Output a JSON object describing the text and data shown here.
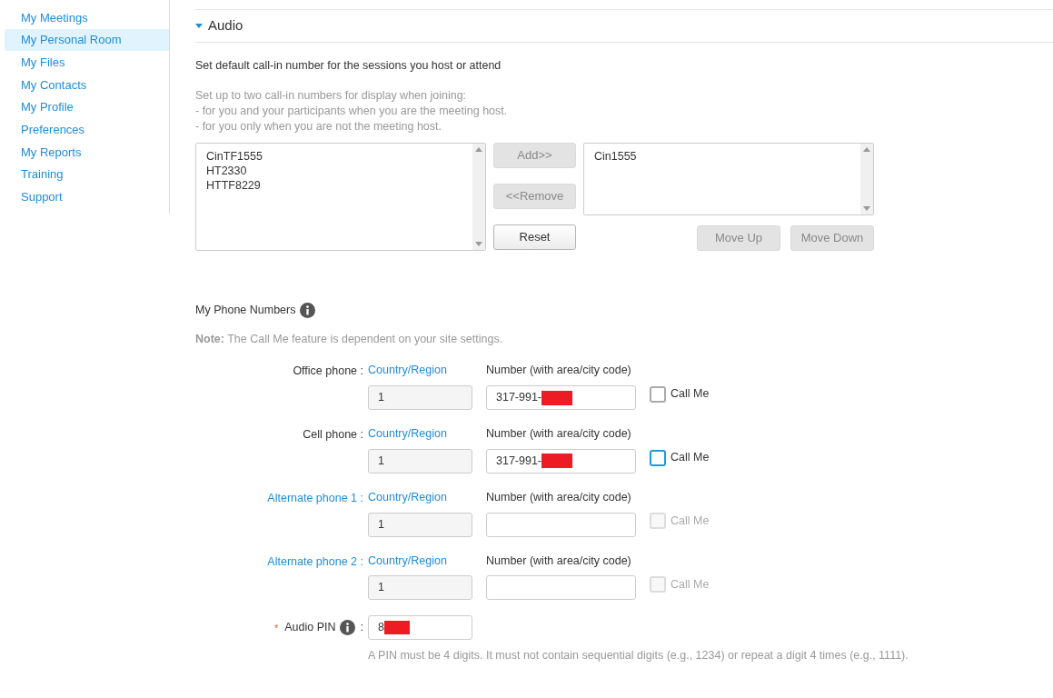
{
  "sidebar": {
    "items": [
      {
        "label": "My Meetings",
        "selected": false
      },
      {
        "label": "My Personal Room",
        "selected": true
      },
      {
        "label": "My Files",
        "selected": false
      },
      {
        "label": "My Contacts",
        "selected": false
      },
      {
        "label": "My Profile",
        "selected": false
      },
      {
        "label": "Preferences",
        "selected": false
      },
      {
        "label": "My Reports",
        "selected": false
      },
      {
        "label": "Training",
        "selected": false
      },
      {
        "label": "Support",
        "selected": false
      }
    ]
  },
  "section": {
    "title": "Audio",
    "expanded": true
  },
  "callin": {
    "heading": "Set default call-in number for the sessions you host or attend",
    "help": [
      "Set up to two call-in numbers for display when joining:",
      "- for you and your participants when you are the meeting host.",
      "- for you only when you are not the meeting host."
    ],
    "available": [
      "CinTF1555",
      "HT2330",
      "HTTF8229"
    ],
    "selected_numbers": [
      "Cin1555"
    ],
    "middle_buttons": [
      {
        "label": "Add>>",
        "disabled": true
      },
      {
        "label": "<<Remove",
        "disabled": true
      },
      {
        "label": "Reset",
        "disabled": false
      }
    ],
    "order_buttons": [
      {
        "label": "Move Up",
        "disabled": true
      },
      {
        "label": "Move Down",
        "disabled": true
      }
    ]
  },
  "phones": {
    "title": "My Phone Numbers",
    "note_label": "Note:",
    "note": "The Call Me feature is dependent on your site settings.",
    "rows": [
      {
        "label": "Office phone :",
        "link": false,
        "country_label": "Country/Region",
        "number_label": "Number (with area/city code)",
        "country": "1",
        "number": "317-991-",
        "redacted": true,
        "call_me": "Call Me",
        "checked": false,
        "color": "#aaaaaa",
        "disabled": false
      },
      {
        "label": "Cell phone :",
        "link": false,
        "country_label": "Country/Region",
        "number_label": "Number (with area/city code)",
        "country": "1",
        "number": "317-991-",
        "redacted": true,
        "call_me": "Call Me",
        "checked": false,
        "color": "#1f9bd8",
        "disabled": false
      },
      {
        "label": "Alternate phone 1 :",
        "link": true,
        "country_label": "Country/Region",
        "number_label": "Number (with area/city code)",
        "country": "1",
        "number": "",
        "redacted": false,
        "call_me": "Call Me",
        "checked": false,
        "color": "#dddddd",
        "disabled": true
      },
      {
        "label": "Alternate phone 2 :",
        "link": true,
        "country_label": "Country/Region",
        "number_label": "Number (with area/city code)",
        "country": "1",
        "number": "",
        "redacted": false,
        "call_me": "Call Me",
        "checked": false,
        "color": "#dddddd",
        "disabled": true
      }
    ],
    "pin": {
      "required_mark": "*",
      "label": "Audio PIN",
      "colon": ":",
      "value": "8",
      "redacted": true,
      "hint": "A PIN must be 4 digits. It must not contain sequential digits (e.g., 1234) or repeat a digit 4 times (e.g., 1111)."
    }
  }
}
